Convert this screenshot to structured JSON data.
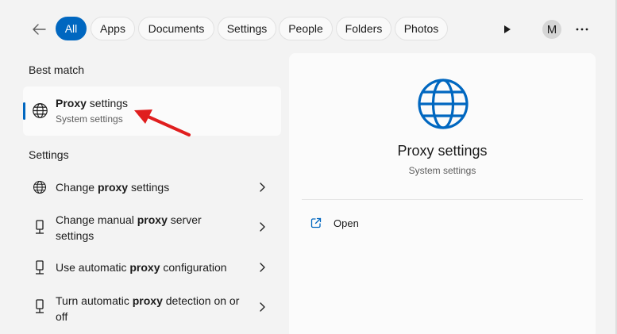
{
  "filters": {
    "back_icon": "arrow-left-icon",
    "chips": [
      {
        "label": "All",
        "active": true
      },
      {
        "label": "Apps",
        "active": false
      },
      {
        "label": "Documents",
        "active": false
      },
      {
        "label": "Settings",
        "active": false
      },
      {
        "label": "People",
        "active": false
      },
      {
        "label": "Folders",
        "active": false
      },
      {
        "label": "Photos",
        "active": false
      }
    ],
    "play_icon": "play-icon",
    "avatar_initial": "M",
    "more_icon": "ellipsis-icon"
  },
  "best_match": {
    "heading": "Best match",
    "item": {
      "title_bold": "Proxy",
      "title_rest": " settings",
      "subtitle": "System settings",
      "icon": "globe-icon"
    }
  },
  "settings": {
    "heading": "Settings",
    "items": [
      {
        "pre": "Change ",
        "bold": "proxy",
        "post": " settings",
        "icon": "globe-icon"
      },
      {
        "pre": "Change manual ",
        "bold": "proxy",
        "post": " server settings",
        "icon": "network-plug-icon"
      },
      {
        "pre": "Use automatic ",
        "bold": "proxy",
        "post": " configuration",
        "icon": "network-plug-icon"
      },
      {
        "pre": "Turn automatic ",
        "bold": "proxy",
        "post": " detection on or off",
        "icon": "network-plug-icon"
      }
    ]
  },
  "preview": {
    "title": "Proxy settings",
    "subtitle": "System settings",
    "icon": "globe-icon",
    "actions": [
      {
        "label": "Open",
        "icon": "open-external-icon"
      }
    ]
  },
  "colors": {
    "accent": "#0067c0",
    "annotation_arrow": "#e01e1e",
    "background": "#f3f3f3",
    "card": "#fbfbfb"
  }
}
